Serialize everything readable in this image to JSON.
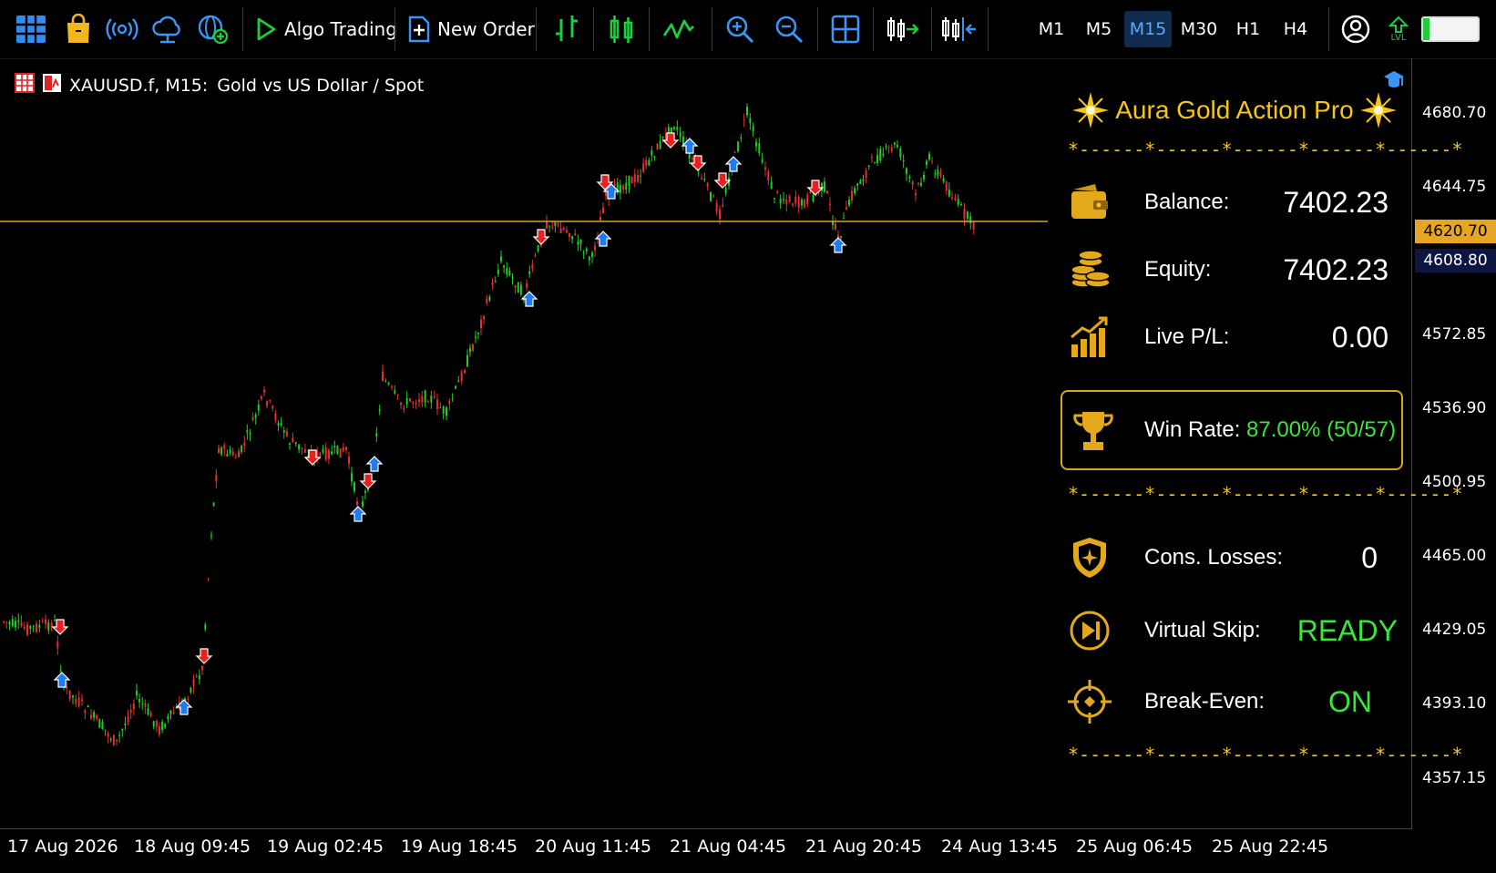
{
  "toolbar": {
    "buttons": [
      {
        "name": "grid-menu-icon"
      },
      {
        "name": "market-bag-icon"
      },
      {
        "name": "signal-broadcast-icon"
      },
      {
        "name": "cloud-icon"
      },
      {
        "name": "web-add-icon"
      },
      {
        "name": "algo-trading-button",
        "label": "Algo Trading",
        "icon": "play-icon"
      },
      {
        "name": "new-order-button",
        "label": "New Order",
        "icon": "new-order-icon"
      },
      {
        "name": "bar-chart-icon"
      },
      {
        "name": "candlestick-icon"
      },
      {
        "name": "line-chart-icon"
      },
      {
        "name": "zoom-in-icon"
      },
      {
        "name": "zoom-out-icon"
      },
      {
        "name": "tile-windows-icon"
      },
      {
        "name": "autoscroll-icon"
      },
      {
        "name": "chart-shift-icon"
      }
    ],
    "timeframes": [
      "M1",
      "M5",
      "M15",
      "M30",
      "H1",
      "H4"
    ],
    "active_timeframe": "M15",
    "account_icon": "account-icon",
    "level_label": "LVL",
    "level_fill": 0.12
  },
  "chart": {
    "symbol": "XAUUSD.f, M15:",
    "description": "Gold vs US Dollar / Spot",
    "current_price": "4620.70",
    "bid_price": "4608.80",
    "price_ticks": [
      "4680.70",
      "4644.75",
      "4572.85",
      "4536.90",
      "4500.95",
      "4465.00",
      "4429.05",
      "4393.10",
      "4357.15"
    ],
    "time_ticks": [
      "17 Aug 2026",
      "18 Aug 09:45",
      "19 Aug 02:45",
      "19 Aug 18:45",
      "20 Aug 11:45",
      "21 Aug 04:45",
      "21 Aug 20:45",
      "24 Aug 13:45",
      "25 Aug 06:45",
      "25 Aug 22:45"
    ],
    "colors": {
      "bull": "#1fcf1f",
      "bear": "#e23030",
      "price_line": "#d9a620",
      "buy_arrow": "#1e7bf0",
      "sell_arrow": "#e82020"
    }
  },
  "panel": {
    "title": "Aura Gold Action Pro",
    "divider": "*------*------*------*------*------*",
    "balance_label": "Balance:",
    "balance_value": "7402.23",
    "equity_label": "Equity:",
    "equity_value": "7402.23",
    "pl_label": "Live P/L:",
    "pl_value": "0.00",
    "winrate_label": "Win Rate:",
    "winrate_value": "87.00%  (50/57)",
    "losses_label": "Cons. Losses:",
    "losses_value": "0",
    "skip_label": "Virtual Skip:",
    "skip_value": "READY",
    "be_label": "Break-Even:",
    "be_value": "ON",
    "accent_color": "#f5c518"
  }
}
